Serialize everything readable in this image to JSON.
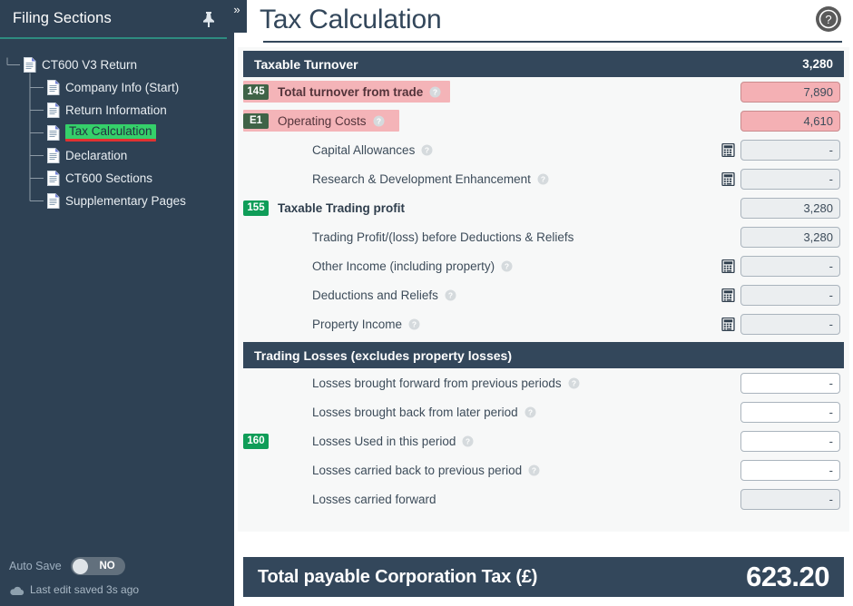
{
  "sidebar": {
    "title": "Filing Sections",
    "pin_icon": "pin-icon",
    "collapse_icon": "chevron-double-right-icon",
    "tree": [
      {
        "label": "CT600 V3 Return",
        "level": 0,
        "selected": false
      },
      {
        "label": "Company Info (Start)",
        "level": 1,
        "selected": false
      },
      {
        "label": "Return Information",
        "level": 1,
        "selected": false
      },
      {
        "label": "Tax Calculation",
        "level": 1,
        "selected": true
      },
      {
        "label": "Declaration",
        "level": 1,
        "selected": false
      },
      {
        "label": "CT600 Sections",
        "level": 1,
        "selected": false
      },
      {
        "label": "Supplementary Pages",
        "level": 1,
        "selected": false
      }
    ],
    "footer": {
      "autosave_label": "Auto Save",
      "autosave_state": "NO",
      "saved_text": "Last edit saved 3s ago",
      "cloud_icon": "cloud-icon"
    }
  },
  "header": {
    "title": "Tax Calculation",
    "help_icon": "help-circle-icon"
  },
  "sections": [
    {
      "name": "taxable-turnover",
      "bar_title": "Taxable Turnover",
      "bar_value": "3,280",
      "rows": [
        {
          "badge": "145",
          "badge_style": "muted",
          "label": "Total turnover from trade",
          "help": true,
          "value": "7,890",
          "field": "pink",
          "calc": false,
          "indent": false,
          "bold": true,
          "highlight": true,
          "hl_width": 228
        },
        {
          "badge": "E1",
          "badge_style": "muted",
          "label": "Operating Costs",
          "help": true,
          "value": "4,610",
          "field": "pink",
          "calc": false,
          "indent": false,
          "bold": false,
          "highlight": true,
          "hl_width": 172
        },
        {
          "badge": "",
          "badge_style": "hidden",
          "label": "Capital Allowances",
          "help": true,
          "value": "-",
          "field": "grey",
          "calc": true,
          "indent": true,
          "bold": false,
          "highlight": false,
          "hl_width": 0
        },
        {
          "badge": "",
          "badge_style": "hidden",
          "label": "Research & Development Enhancement",
          "help": true,
          "value": "-",
          "field": "grey",
          "calc": true,
          "indent": true,
          "bold": false,
          "highlight": false,
          "hl_width": 0
        },
        {
          "badge": "155",
          "badge_style": "green",
          "label": "Taxable Trading profit",
          "help": false,
          "value": "3,280",
          "field": "grey",
          "calc": false,
          "indent": false,
          "bold": true,
          "highlight": false,
          "hl_width": 0
        },
        {
          "badge": "",
          "badge_style": "hidden",
          "label": "Trading Profit/(loss) before Deductions & Reliefs",
          "help": false,
          "value": "3,280",
          "field": "grey",
          "calc": false,
          "indent": true,
          "bold": false,
          "highlight": false,
          "hl_width": 0
        },
        {
          "badge": "",
          "badge_style": "hidden",
          "label": "Other Income (including property)",
          "help": true,
          "value": "-",
          "field": "grey",
          "calc": true,
          "indent": true,
          "bold": false,
          "highlight": false,
          "hl_width": 0
        },
        {
          "badge": "",
          "badge_style": "hidden",
          "label": "Deductions and Reliefs",
          "help": true,
          "value": "-",
          "field": "grey",
          "calc": true,
          "indent": true,
          "bold": false,
          "highlight": false,
          "hl_width": 0
        },
        {
          "badge": "",
          "badge_style": "hidden",
          "label": "Property Income",
          "help": true,
          "value": "-",
          "field": "grey",
          "calc": true,
          "indent": true,
          "bold": false,
          "highlight": false,
          "hl_width": 0
        }
      ]
    },
    {
      "name": "trading-losses",
      "bar_title": "Trading Losses (excludes property losses)",
      "bar_value": "",
      "rows": [
        {
          "badge": "",
          "badge_style": "hidden",
          "label": "Losses brought forward from previous periods",
          "help": true,
          "value": "-",
          "field": "white",
          "calc": false,
          "indent": true,
          "bold": false,
          "highlight": false,
          "hl_width": 0
        },
        {
          "badge": "",
          "badge_style": "hidden",
          "label": "Losses brought back from later period",
          "help": true,
          "value": "-",
          "field": "white",
          "calc": false,
          "indent": true,
          "bold": false,
          "highlight": false,
          "hl_width": 0
        },
        {
          "badge": "160",
          "badge_style": "green",
          "label": "Losses Used in this period",
          "help": true,
          "value": "-",
          "field": "white",
          "calc": false,
          "indent": true,
          "bold": false,
          "highlight": false,
          "hl_width": 0
        },
        {
          "badge": "",
          "badge_style": "hidden",
          "label": "Losses carried back to previous period",
          "help": true,
          "value": "-",
          "field": "white",
          "calc": false,
          "indent": true,
          "bold": false,
          "highlight": false,
          "hl_width": 0
        },
        {
          "badge": "",
          "badge_style": "hidden",
          "label": "Losses carried forward",
          "help": false,
          "value": "-",
          "field": "grey",
          "calc": false,
          "indent": true,
          "bold": false,
          "highlight": false,
          "hl_width": 0
        }
      ]
    }
  ],
  "total": {
    "label": "Total payable Corporation Tax (£)",
    "value": "623.20"
  },
  "colors": {
    "navy": "#33475b",
    "sidebar": "#2e4154",
    "accent_teal": "#2e8b80",
    "badge_green": "#0f9d58",
    "highlight_pink": "#f4b4b8",
    "selection_green": "#35d06a",
    "selection_underline": "#e03131"
  }
}
